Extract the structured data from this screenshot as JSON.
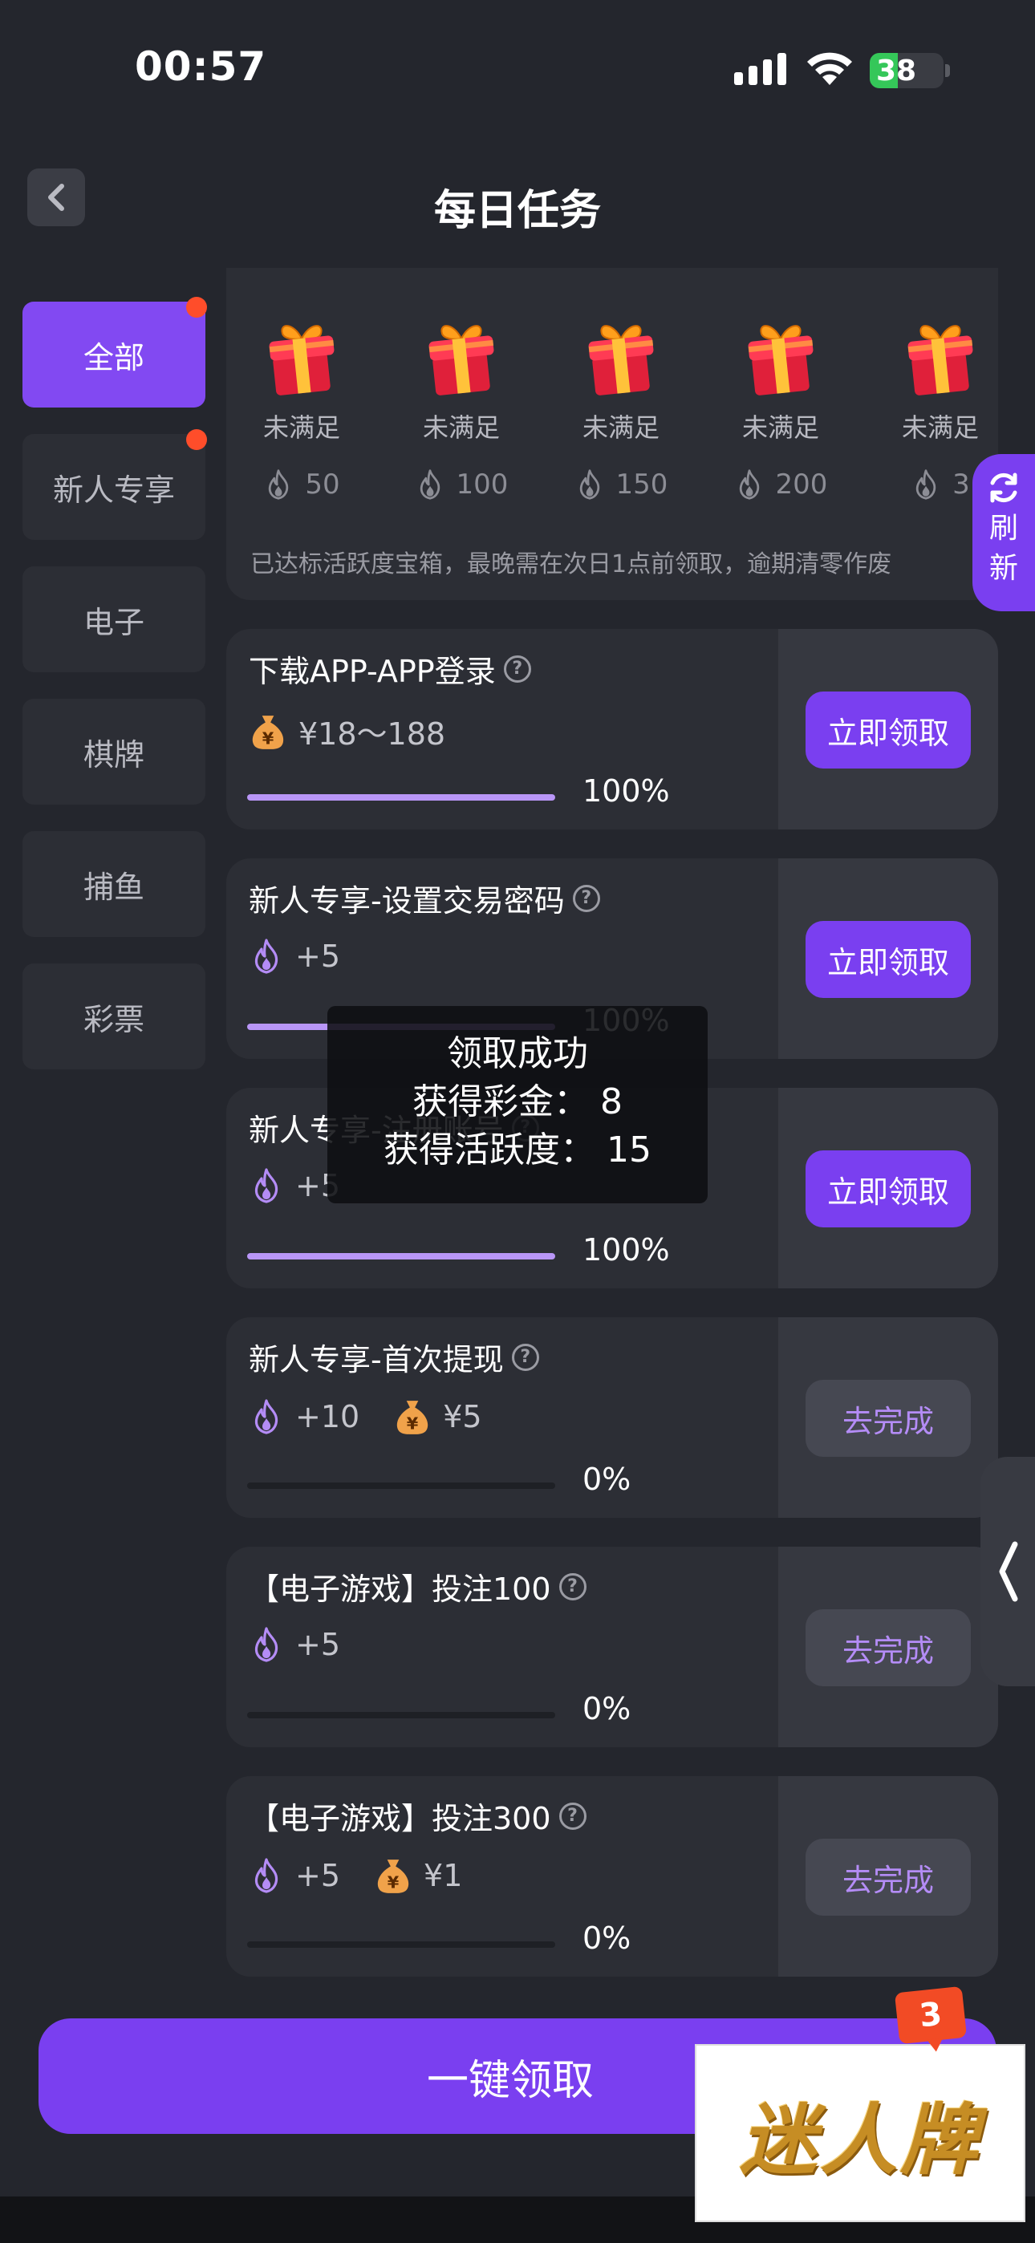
{
  "status_bar": {
    "time": "00:57",
    "battery": "38",
    "battery_level": 0.38
  },
  "header": {
    "title": "每日任务"
  },
  "sidebar": {
    "items": [
      {
        "label": "全部",
        "active": true,
        "dot": true
      },
      {
        "label": "新人专享",
        "active": false,
        "dot": true
      },
      {
        "label": "电子",
        "active": false,
        "dot": false
      },
      {
        "label": "棋牌",
        "active": false,
        "dot": false
      },
      {
        "label": "捕鱼",
        "active": false,
        "dot": false
      },
      {
        "label": "彩票",
        "active": false,
        "dot": false
      }
    ]
  },
  "chests": {
    "items": [
      {
        "label": "未满足",
        "value": "50"
      },
      {
        "label": "未满足",
        "value": "100"
      },
      {
        "label": "未满足",
        "value": "150"
      },
      {
        "label": "未满足",
        "value": "200"
      },
      {
        "label": "未满足",
        "value": "3"
      }
    ],
    "note": "已达标活跃度宝箱，最晚需在次日1点前领取，逾期清零作废"
  },
  "refresh": {
    "label_1": "刷",
    "label_2": "新"
  },
  "tasks": [
    {
      "title": "下载APP-APP登录",
      "rewards": [
        {
          "type": "money",
          "text": "¥18～188"
        }
      ],
      "progress": 1.0,
      "percent": "100%",
      "action": "立即领取",
      "state": "claim"
    },
    {
      "title": "新人专享-设置交易密码",
      "rewards": [
        {
          "type": "fire",
          "text": "+5"
        }
      ],
      "progress": 1.0,
      "percent": "100%",
      "action": "立即领取",
      "state": "claim"
    },
    {
      "title": "新人专享-注册账号",
      "rewards": [
        {
          "type": "fire",
          "text": "+5"
        }
      ],
      "progress": 1.0,
      "percent": "100%",
      "action": "立即领取",
      "state": "claim"
    },
    {
      "title": "新人专享-首次提现",
      "rewards": [
        {
          "type": "fire",
          "text": "+10"
        },
        {
          "type": "money",
          "text": "¥5"
        }
      ],
      "progress": 0.0,
      "percent": "0%",
      "action": "去完成",
      "state": "go"
    },
    {
      "title": "【电子游戏】投注100",
      "rewards": [
        {
          "type": "fire",
          "text": "+5"
        }
      ],
      "progress": 0.0,
      "percent": "0%",
      "action": "去完成",
      "state": "go"
    },
    {
      "title": "【电子游戏】投注300",
      "rewards": [
        {
          "type": "fire",
          "text": "+5"
        },
        {
          "type": "money",
          "text": "¥1"
        }
      ],
      "progress": 0.0,
      "percent": "0%",
      "action": "去完成",
      "state": "go"
    }
  ],
  "toast": {
    "line1": "领取成功",
    "line2": "获得彩金： 8",
    "line3": "获得活跃度： 15"
  },
  "bottom": {
    "claim_all": "一键领取"
  },
  "ad": {
    "text": "迷人牌",
    "badge": "3"
  },
  "colors": {
    "accent": "#7a3ff0",
    "background": "#24262d",
    "card": "#2c2e35",
    "fire": "#b48cf6",
    "money": "#f0a24a"
  }
}
